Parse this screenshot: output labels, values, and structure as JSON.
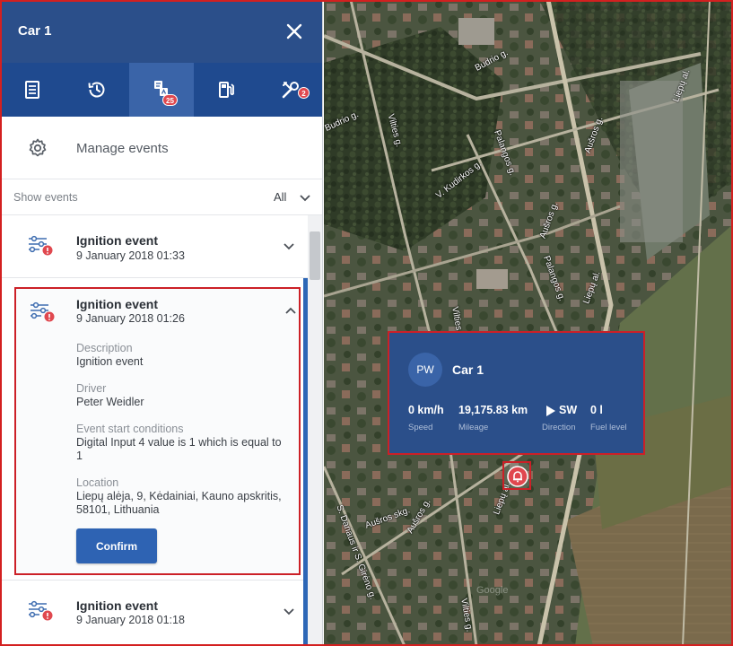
{
  "header": {
    "title": "Car 1"
  },
  "tabs": [
    {
      "icon": "document-icon"
    },
    {
      "icon": "history-icon"
    },
    {
      "icon": "events-icon",
      "badge": "25"
    },
    {
      "icon": "fuel-icon"
    },
    {
      "icon": "tools-icon",
      "badge": "2"
    }
  ],
  "manage": {
    "label": "Manage events"
  },
  "filter": {
    "label": "Show events",
    "value": "All"
  },
  "events": [
    {
      "title": "Ignition event",
      "date": "9 January 2018 01:33"
    },
    {
      "title": "Ignition event",
      "date": "9 January 2018 01:26",
      "description_label": "Description",
      "description": "Ignition event",
      "driver_label": "Driver",
      "driver": "Peter Weidler",
      "conditions_label": "Event start conditions",
      "conditions": "Digital Input 4 value is 1 which is equal to 1",
      "location_label": "Location",
      "location": "Liepų alėja, 9, Kėdainiai, Kauno apskritis, 58101, Lithuania",
      "confirm_label": "Confirm"
    },
    {
      "title": "Ignition event",
      "date": "9 January 2018 01:18"
    }
  ],
  "map": {
    "streets": [
      "Budrio g.",
      "Budrio g.",
      "Liepų al.",
      "Vilties g.",
      "Palangos g.",
      "Aušros g.",
      "V. Kudirkos g.",
      "Aušros g.",
      "Palangos g.",
      "Liepų al.",
      "Vilties g.",
      "Aušros skg.",
      "Aušros g.",
      "S. Dariaus ir S. Girėno g.",
      "Liepų al.",
      "Vilties g."
    ],
    "watermark": "Google"
  },
  "popup": {
    "initials": "PW",
    "name": "Car 1",
    "speed": "0 km/h",
    "speed_label": "Speed",
    "mileage": "19,175.83 km",
    "mileage_label": "Mileage",
    "direction": "SW",
    "direction_label": "Direction",
    "fuel": "0 l",
    "fuel_label": "Fuel level"
  },
  "colors": {
    "header": "#2b4f8a",
    "tabs": "#1f4a8f",
    "accent": "#2e63b3",
    "alert": "#e0484f",
    "highlight": "#cc2027"
  }
}
